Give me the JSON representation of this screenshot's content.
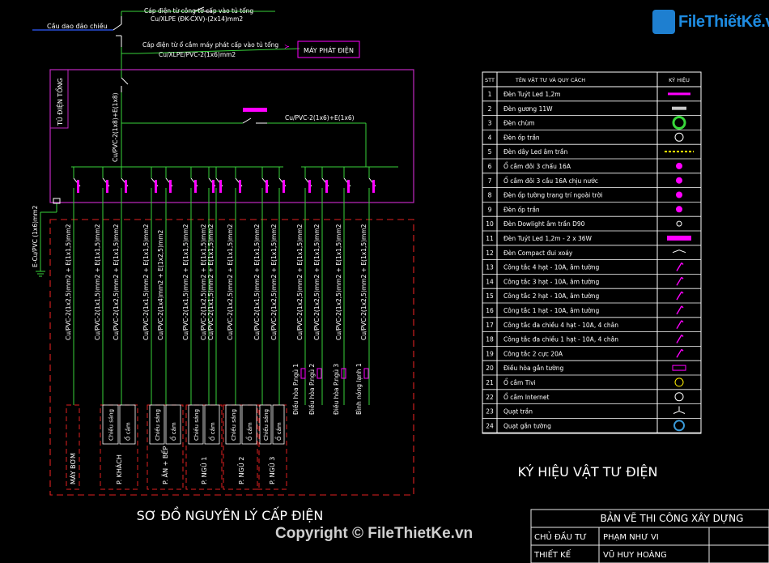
{
  "brand": {
    "logo_text": "FileThiếtKế.vn"
  },
  "diagram": {
    "title": "SƠ ĐỒ NGUYÊN LÝ CẤP ĐIỆN",
    "incoming_label": "Cầu dao đảo chiều",
    "feed1": [
      "Cáp điện từ công tơ cấp vào tủ tổng",
      "Cu/XLPE (ĐK-CXV)-(2x14)mm2"
    ],
    "feed2": [
      "Cáp điện từ ổ cắm máy phát cấp vào tủ tổng",
      "Cu/XLPE/PVC-2(1x6)mm2"
    ],
    "generator": "MÁY PHÁT ĐIỆN",
    "panel": "TỦ ĐIỆN TỔNG",
    "main_cable": "Cu/PVC-2(1x8)+E(1x8)",
    "branch_cable": "Cu/PVC-2(1x6)+E(1x6)",
    "earth_cable": "E-Cu/PVC (1x6)mm2",
    "circuit_cables": [
      "Cu/PVC-2(1x2,5)mm2 + E(1x1,5)mm2",
      "Cu/PVC-2(1x1,5)mm2 + E(1x1,5)mm2",
      "Cu/PVC-2(1x2,5)mm2 + E(1x1,5)mm2",
      "Cu/PVC-2(1x1,5)mm2 + E(1x1,5)mm2",
      "Cu/PVC-2(1x4)mm2 + E(1x2,5)mm2",
      "Cu/PVC-2(1x1,5)mm2 + E(1x1,5)mm2",
      "Cu/PVC-2(1x2,5)mm2 + E(1x1,5)mm2",
      "Cu/PVC-2(1x1,5)mm2 + E(1x1,5)mm2",
      "Cu/PVC-2(1x2,5)mm2 + E(1x1,5)mm2",
      "Cu/PVC-2(1x1,5)mm2 + E(1x1,5)mm2",
      "Cu/PVC-2(1x2,5)mm2 + E(1x1,5)mm2",
      "Cu/PVC-2(1x2,5)mm2 + E(1x1,5)mm2",
      "Cu/PVC-2(1x2,5)mm2 + E(1x1,5)mm2",
      "Cu/PVC-2(1x2,5)mm2 + E(1x1,5)mm2",
      "Cu/PVC-2(1x2,5)mm2 + E(1x1,5)mm2"
    ],
    "ac_loads": [
      "Điều hòa P.ngủ 1",
      "Điều hòa P.ngủ 2",
      "Điều hòa P.ngủ 3",
      "Bình nóng lạnh 1"
    ],
    "rooms": [
      "MÁY BƠM",
      "P. KHÁCH",
      "P. ĂN + BẾP",
      "P. NGỦ 1",
      "P. NGỦ 2",
      "P. NGỦ 3"
    ],
    "sub_lighting": "Chiếu sáng",
    "sub_socket": "Ổ cắm"
  },
  "legend": {
    "title": "KÝ HIỆU VẬT TƯ ĐIỆN",
    "headers": [
      "STT",
      "TÊN VẬT TƯ VÀ QUY CÁCH",
      "KÝ HIỆU"
    ],
    "rows": [
      {
        "no": "1",
        "name": "Đèn Tuýt Led 1,2m"
      },
      {
        "no": "2",
        "name": "Đèn gương 11W"
      },
      {
        "no": "3",
        "name": "Đèn chùm"
      },
      {
        "no": "4",
        "name": "Đèn ốp trần"
      },
      {
        "no": "5",
        "name": "Đèn dây Led âm trần"
      },
      {
        "no": "6",
        "name": "Ổ cắm đôi 3 chấu 16A"
      },
      {
        "no": "7",
        "name": "Ổ cắm đôi 3 cầu 16A chịu nước"
      },
      {
        "no": "8",
        "name": "Đèn ốp tường trang trí ngoài trời"
      },
      {
        "no": "9",
        "name": "Đèn ốp trần"
      },
      {
        "no": "10",
        "name": "Đèn Dowlight âm trần D90"
      },
      {
        "no": "11",
        "name": "Đèn Tuýt Led 1,2m - 2 x 36W"
      },
      {
        "no": "12",
        "name": "Đèn Compact đui xoáy"
      },
      {
        "no": "13",
        "name": "Công tắc 4 hạt - 10A, âm tường"
      },
      {
        "no": "14",
        "name": "Công tắc 3 hạt - 10A, âm tường"
      },
      {
        "no": "15",
        "name": "Công tắc 2 hạt - 10A, âm tường"
      },
      {
        "no": "16",
        "name": "Công tắc 1 hạt - 10A, âm tường"
      },
      {
        "no": "17",
        "name": "Công tắc đa chiều 4 hạt - 10A, 4 chân"
      },
      {
        "no": "18",
        "name": "Công tắc đa chiều 1 hạt - 10A, 4 chân"
      },
      {
        "no": "19",
        "name": "Công tắc 2 cực 20A"
      },
      {
        "no": "20",
        "name": "Điều hòa gắn tường"
      },
      {
        "no": "21",
        "name": "Ổ cắm Tivi"
      },
      {
        "no": "22",
        "name": "Ổ cắm Internet"
      },
      {
        "no": "23",
        "name": "Quạt trần"
      },
      {
        "no": "24",
        "name": "Quạt gắn tường"
      }
    ]
  },
  "title_block": {
    "heading": "BẢN VẼ THI CÔNG XÂY DỰNG",
    "rows": [
      {
        "label": "CHỦ ĐẦU TƯ",
        "value": "PHẠM NHƯ VI"
      },
      {
        "label": "THIẾT KẾ",
        "value": "VŨ HUY HOÀNG"
      }
    ]
  },
  "watermark": "Copyright © FileThietKe.vn",
  "colors": {
    "background": "#000000",
    "wire": "#37d23a",
    "panel": "#c028c0",
    "dashed": "#e02020",
    "text": "#ffffff",
    "breaker": "#ffffff",
    "accent_yellow": "#ffee00",
    "accent_magenta": "#ff00ff",
    "legend_border": "#ffffff",
    "title_block": "#e8e8e8",
    "incoming": "#2f5bff"
  }
}
